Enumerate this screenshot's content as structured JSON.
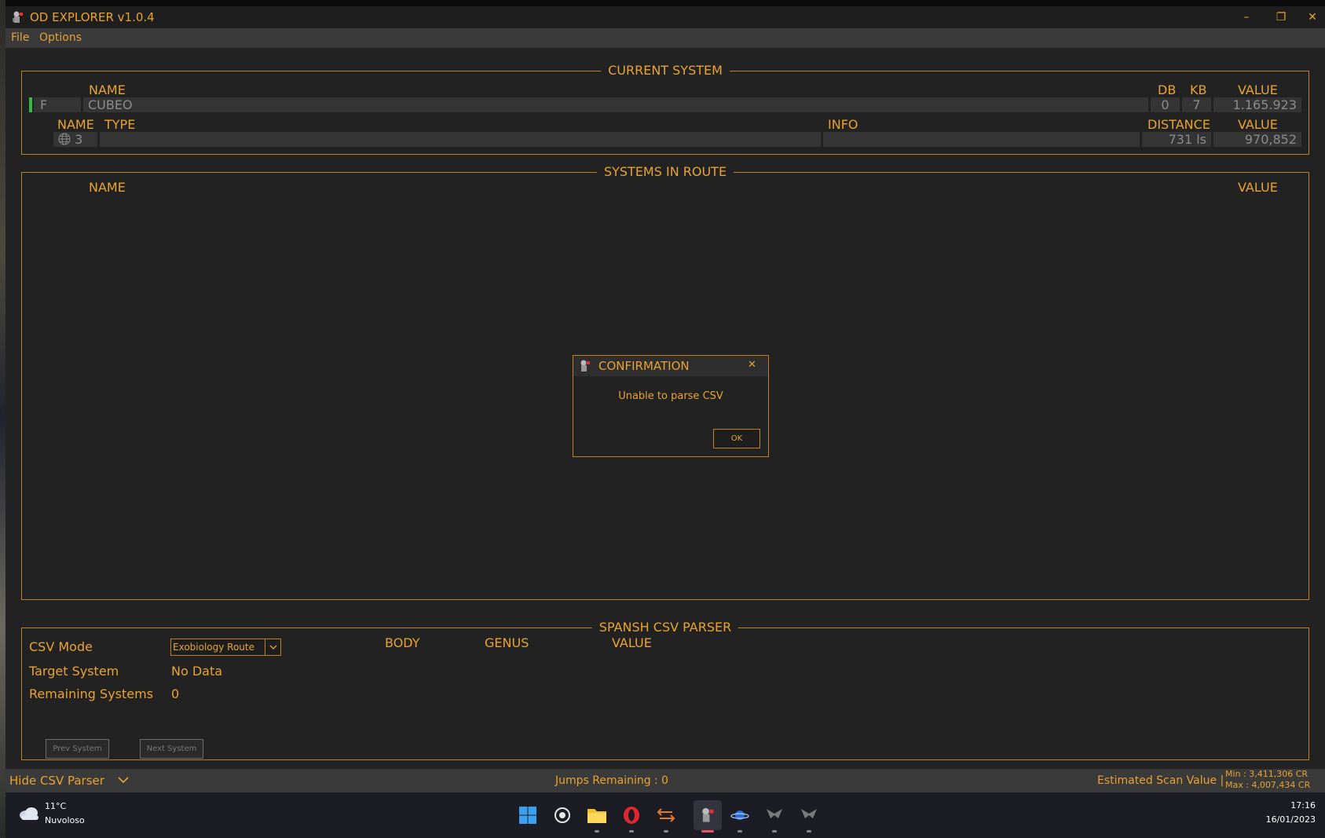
{
  "window": {
    "title": "OD EXPLORER v1.0.4",
    "controls": {
      "minimize": "–",
      "restore": "❐",
      "close": "✕"
    }
  },
  "menu": {
    "file": "File",
    "options": "Options"
  },
  "current_system": {
    "title": "CURRENT SYSTEM",
    "headers": {
      "name": "NAME",
      "db": "DB",
      "kb": "KB",
      "value": "VALUE"
    },
    "row": {
      "star_class": "F",
      "name": "CUBEO",
      "db": "0",
      "kb": "7",
      "value": "1.165.923"
    },
    "body_headers": {
      "name": "NAME",
      "type": "TYPE",
      "info": "INFO",
      "distance": "DISTANCE",
      "value": "VALUE"
    },
    "body_row": {
      "name": "3",
      "type": "",
      "info": "",
      "distance": "731 ls",
      "value": "970,852"
    }
  },
  "systems_in_route": {
    "title": "SYSTEMS IN ROUTE",
    "headers": {
      "name": "NAME",
      "value": "VALUE"
    }
  },
  "dialog": {
    "title": "CONFIRMATION",
    "message": "Unable to parse CSV",
    "ok_label": "OK",
    "close": "✕"
  },
  "csv_parser": {
    "title": "SPANSH CSV PARSER",
    "mode_label": "CSV Mode",
    "mode_value": "Exobiology Route",
    "target_label": "Target System",
    "target_value": "No Data",
    "remaining_label": "Remaining Systems",
    "remaining_value": "0",
    "col_body": "BODY",
    "col_genus": "GENUS",
    "col_value": "VALUE",
    "prev_label": "Prev System",
    "next_label": "Next System"
  },
  "status": {
    "hide_parser": "Hide CSV Parser",
    "jumps_label": "Jumps Remaining :",
    "jumps_value": "0",
    "estimated_label": "Estimated Scan Value |",
    "min_value": "Min : 3,411,306 CR",
    "max_value": "Max : 4,007,434 CR"
  },
  "taskbar": {
    "weather_temp": "11°C",
    "weather_desc": "Nuvoloso",
    "time": "17:16",
    "date": "16/01/2023"
  },
  "colors": {
    "accent": "#e8a332",
    "border": "#c4801c",
    "background": "#222222",
    "star_indicator": "#2fbf3a"
  }
}
